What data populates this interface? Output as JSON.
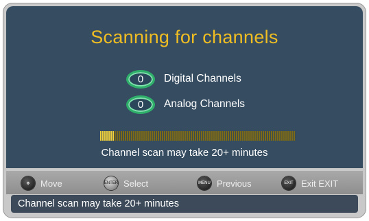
{
  "title": "Scanning for channels",
  "digital": {
    "count": "0",
    "label": "Digital Channels"
  },
  "analog": {
    "count": "0",
    "label": "Analog Channels"
  },
  "progress": {
    "fraction": 0.07
  },
  "scan_note": "Channel scan may take 20+ minutes",
  "hints": {
    "move": {
      "icon": "dpad-icon",
      "label": "Move"
    },
    "select": {
      "icon": "enter-button-icon",
      "icon_text": "ENTER",
      "label": "Select"
    },
    "previous": {
      "icon": "menu-button-icon",
      "icon_text": "MENU",
      "label": "Previous"
    },
    "exit": {
      "icon": "exit-button-icon",
      "icon_text": "EXIT",
      "label": "Exit  EXIT"
    }
  },
  "status_text": "Channel scan may take 20+ minutes",
  "colors": {
    "title": "#f0bd22",
    "panel": "#354c61",
    "oval_ring": "#2fb06a",
    "progress": "#f3d23a"
  }
}
